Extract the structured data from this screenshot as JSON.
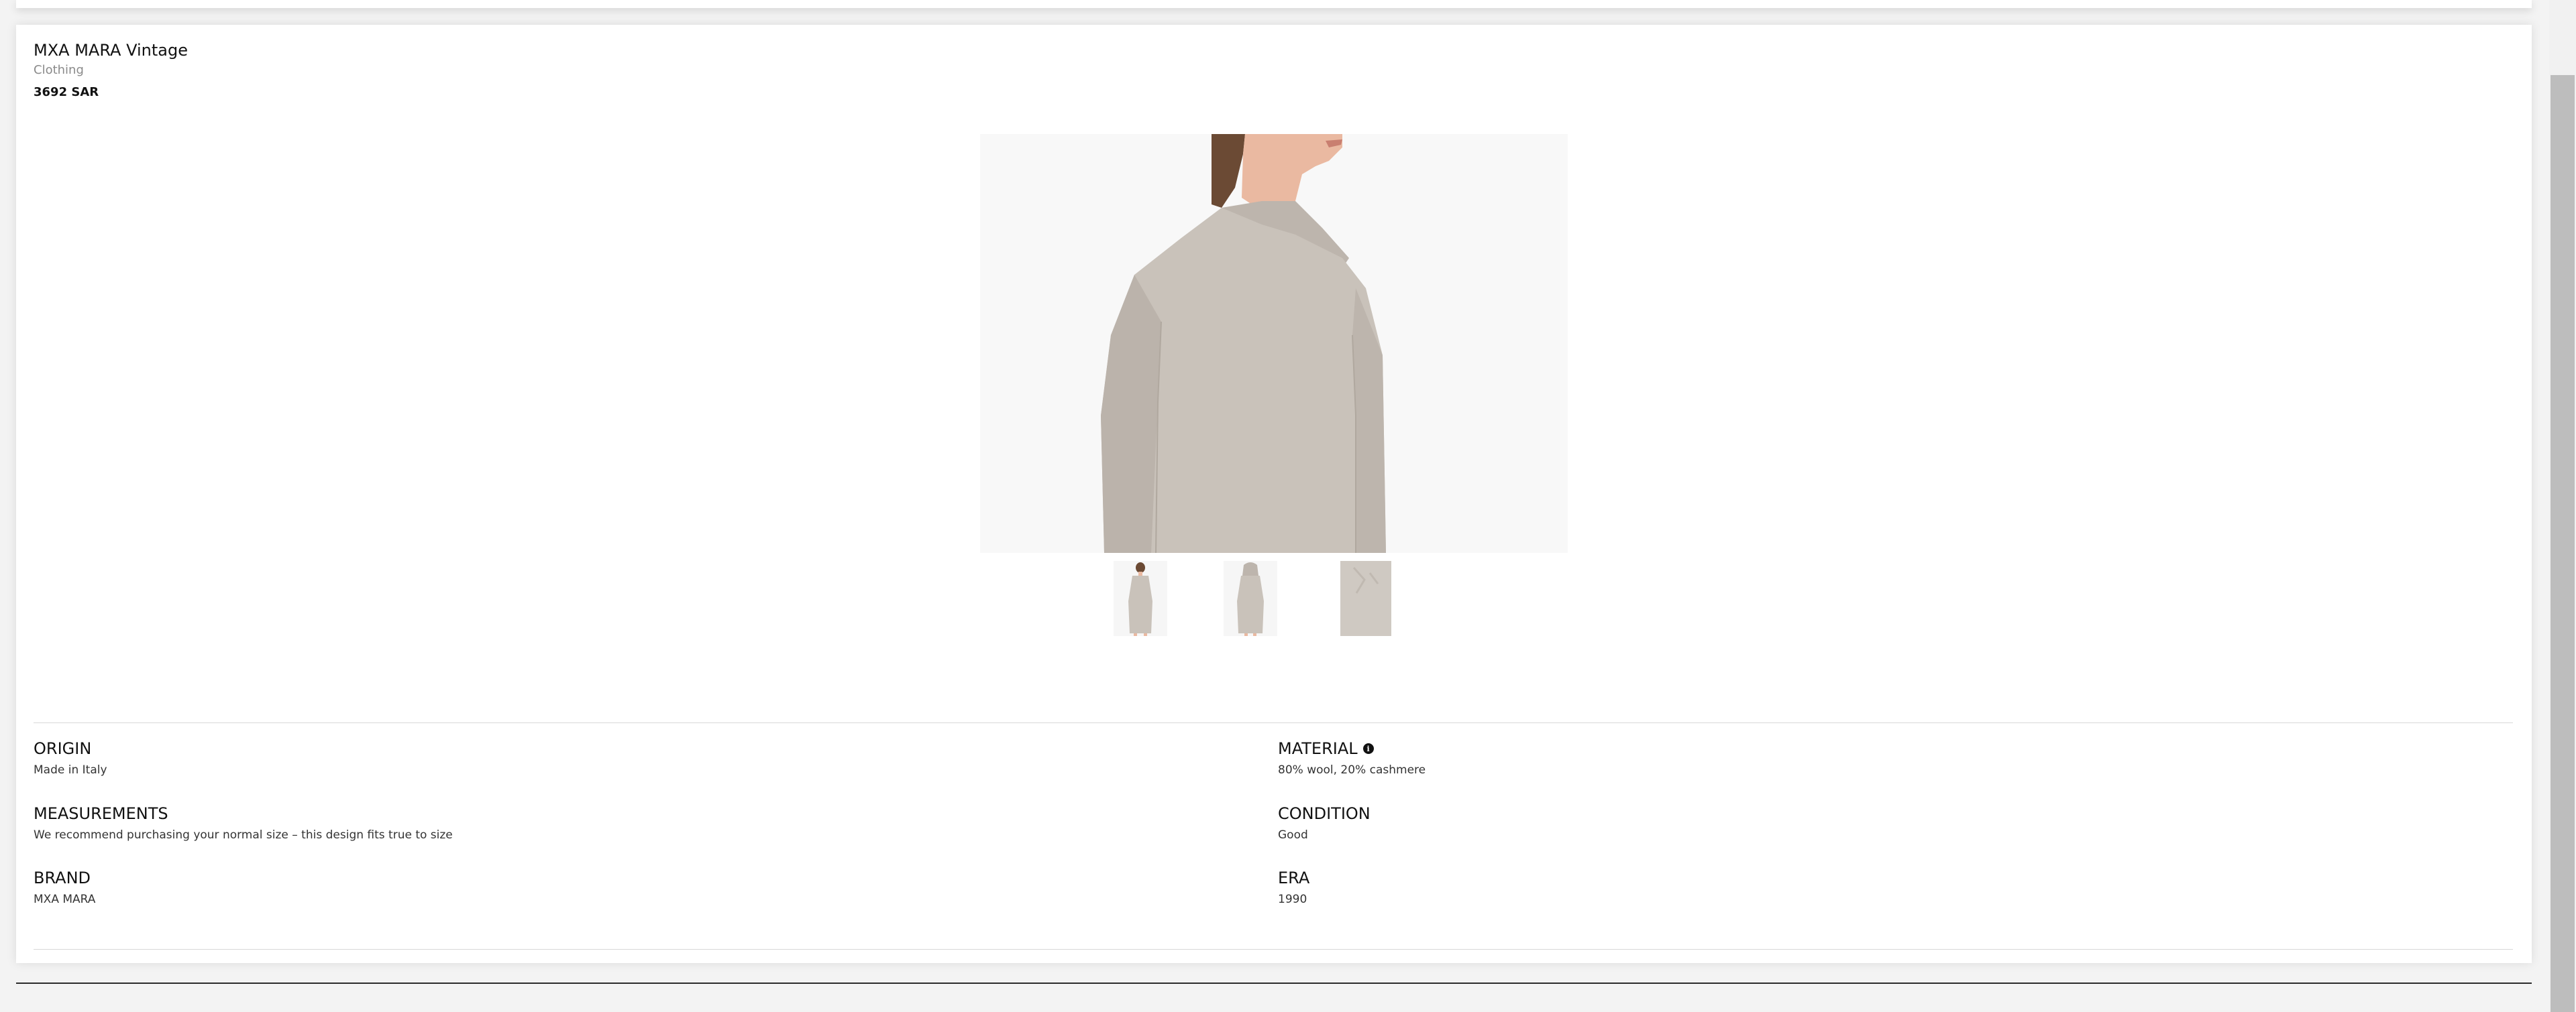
{
  "product": {
    "title": "MXA MARA Vintage",
    "category": "Clothing",
    "price": "3692 SAR"
  },
  "gallery": {
    "main_image": "model-wearing-grey-hooded-knit-dress",
    "thumbnails": [
      "dress-front-full",
      "dress-side-full",
      "fabric-closeup"
    ]
  },
  "specs": {
    "origin_label": "ORIGIN",
    "origin_value": "Made in Italy",
    "material_label": "MATERIAL",
    "material_value": "80% wool, 20% cashmere",
    "measurements_label": "MEASUREMENTS",
    "measurements_value": "We recommend purchasing your normal size – this design fits true to size",
    "condition_label": "CONDITION",
    "condition_value": "Good",
    "brand_label": "BRAND",
    "brand_value": "MXA MARA",
    "era_label": "ERA",
    "era_value": "1990"
  },
  "colors": {
    "garment": "#c9c2ba",
    "background": "#f8f8f8",
    "accent_text": "#111111"
  }
}
